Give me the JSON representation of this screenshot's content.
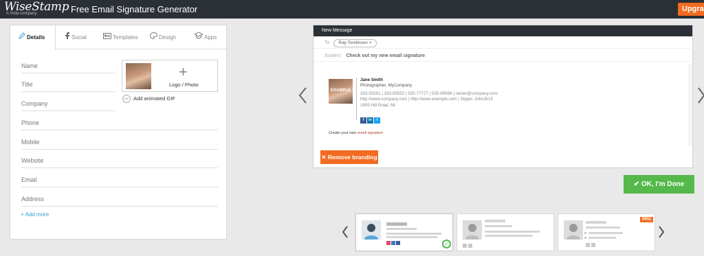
{
  "brand": {
    "logo": "WiseStamp",
    "sub": "A Vista company"
  },
  "app": {
    "title": "Free Email Signature Generator"
  },
  "header": {
    "upgrade_label": "Upgrade"
  },
  "tabs": [
    {
      "label": "Details",
      "icon": "pencil-icon"
    },
    {
      "label": "Social",
      "icon": "facebook-icon"
    },
    {
      "label": "Templates",
      "icon": "id-card-icon"
    },
    {
      "label": "Design",
      "icon": "palette-icon"
    },
    {
      "label": "Apps",
      "icon": "graduation-cap-icon"
    }
  ],
  "form": {
    "fields": [
      "Name",
      "Title",
      "Company",
      "Phone",
      "Mobile",
      "Website",
      "Email",
      "Address"
    ],
    "logo_label": "Logo / Photo",
    "gif_badge": "GIF",
    "gif_label": "Add animated GIF",
    "add_more": "+ Add more"
  },
  "email": {
    "header": "New Message",
    "to_label": "To",
    "to_chip": "Ray Tomlinson",
    "subject_label": "Subject",
    "subject_value": "Check out my new email signature"
  },
  "signature": {
    "photo_label": "EXAMPLE",
    "name": "Jane Smith",
    "title": "Photographer, MyCompany",
    "phones": "333-55551 | 333-55552 | 555-77777 | 555-99999 | owner@company.com",
    "web": "http://www.company.com | http://www.example.com | Skype: John2k15",
    "address": "1905 Hill Road, MI",
    "social": [
      {
        "label": "f",
        "color": "#3b5998"
      },
      {
        "label": "in",
        "color": "#0e76a8"
      },
      {
        "label": "t",
        "color": "#1da1f2"
      }
    ],
    "create_prefix": "Create your own",
    "create_link": "email signature"
  },
  "buttons": {
    "remove_branding": "✕ Remove branding",
    "ok": "✔ OK, I'm Done"
  },
  "templates": {
    "pro_label": "PRO",
    "check": "✓"
  },
  "colors": {
    "topbar": "#2b2f36",
    "accent_orange": "#f26b21",
    "ok_green": "#54b94a",
    "link_blue": "#2f9fd9"
  }
}
